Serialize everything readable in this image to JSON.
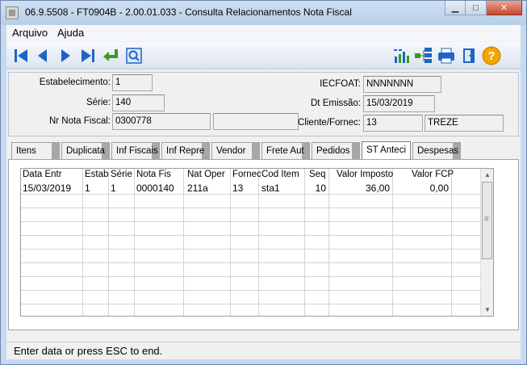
{
  "window": {
    "title": "06.9.5508 - FT0904B - 2.00.01.033 - Consulta Relacionamentos Nota Fiscal"
  },
  "menu": [
    {
      "label": "Arquivo"
    },
    {
      "label": "Ajuda"
    }
  ],
  "toolbar": {
    "nav": [
      {
        "icon": "first-record-icon"
      },
      {
        "icon": "previous-record-icon"
      },
      {
        "icon": "next-record-icon"
      },
      {
        "icon": "last-record-icon"
      },
      {
        "icon": "go-to-icon"
      },
      {
        "icon": "search-icon"
      }
    ],
    "right": [
      {
        "icon": "chart-icon"
      },
      {
        "icon": "tree-icon"
      },
      {
        "icon": "print-icon"
      },
      {
        "icon": "exit-icon"
      },
      {
        "icon": "help-icon"
      }
    ],
    "colors": {
      "arrow": "#1f63c4",
      "goto": "#3b9a1e",
      "help": "#f3a400"
    }
  },
  "form": {
    "estabelecimento": {
      "label": "Estabelecimento:",
      "value": "1"
    },
    "serie": {
      "label": "Série:",
      "value": "140"
    },
    "nr_nota": {
      "label": "Nr Nota Fiscal:",
      "value": "0300778",
      "extra": ""
    },
    "iecfoat": {
      "label": "IECFOAT:",
      "value": "NNNNNNN"
    },
    "dt_emissao": {
      "label": "Dt Emissão:",
      "value": "15/03/2019"
    },
    "cliente": {
      "label": "Cliente/Fornec:",
      "code": "13",
      "name": "TREZE"
    }
  },
  "tabs": [
    {
      "label": "Itens"
    },
    {
      "label": "Duplicata"
    },
    {
      "label": "Inf Fiscais"
    },
    {
      "label": "Inf Repre"
    },
    {
      "label": "Vendor"
    },
    {
      "label": "Frete Aut"
    },
    {
      "label": "Pedidos"
    },
    {
      "label": "ST Anteci",
      "active": true
    },
    {
      "label": "Despesas"
    }
  ],
  "grid": {
    "columns": [
      "Data Entr",
      "Estab",
      "Série",
      "Nota Fis",
      "Nat Oper",
      "Fornec",
      "Cod Item",
      "Seq",
      "Valor Imposto",
      "Valor FCP"
    ],
    "rows": [
      [
        "15/03/2019",
        "1",
        "1",
        "0000140",
        "211a",
        "13",
        "sta1",
        "10",
        "36,00",
        "0,00"
      ]
    ]
  },
  "status": {
    "text": "Enter data or press ESC to end."
  }
}
